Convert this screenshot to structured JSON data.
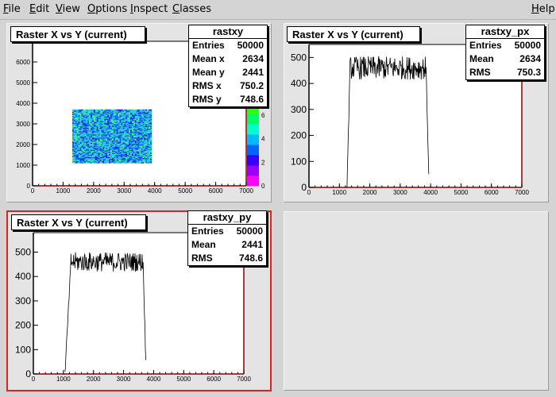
{
  "menu": {
    "items": [
      {
        "label": "File",
        "ul": "F",
        "rest": "ile",
        "x": 4
      },
      {
        "label": "Edit",
        "ul": "E",
        "rest": "dit",
        "x": 37
      },
      {
        "label": "View",
        "ul": "V",
        "rest": "iew",
        "x": 70
      },
      {
        "label": "Options",
        "ul": "O",
        "rest": "ptions",
        "x": 110
      },
      {
        "label": "Inspect",
        "ul": "I",
        "rest": "nspect",
        "x": 164
      },
      {
        "label": "Classes",
        "ul": "C",
        "rest": "lasses",
        "x": 217
      }
    ],
    "help": {
      "label": "Help",
      "ul": "H",
      "rest": "elp"
    }
  },
  "colors": {
    "frame": "#8b0000",
    "pad_bg": "#e4e4e4",
    "selected_border": "#dd2222"
  },
  "chart_data": [
    {
      "type": "heatmap",
      "title": "Raster X vs Y (current)",
      "stats": {
        "name": "rastxy",
        "rows": [
          [
            "Entries",
            "50000"
          ],
          [
            "Mean x",
            "2634"
          ],
          [
            "Mean y",
            "2441"
          ],
          [
            "RMS x",
            "750.2"
          ],
          [
            "RMS y",
            "748.6"
          ]
        ]
      },
      "xlim": [
        0,
        7000
      ],
      "ylim": [
        0,
        7000
      ],
      "x_ticks": [
        "0",
        "1000",
        "2000",
        "3000",
        "4000",
        "5000",
        "6000",
        "7000"
      ],
      "y_ticks": [
        "0",
        "1000",
        "2000",
        "3000",
        "4000",
        "5000",
        "6000"
      ],
      "region": {
        "x": [
          1300,
          3900
        ],
        "y": [
          1100,
          3700
        ]
      },
      "z_ticks": [
        "0",
        "2",
        "4",
        "6"
      ],
      "z_range": [
        0,
        7
      ]
    },
    {
      "type": "line",
      "title": "Raster X vs Y (current)",
      "stats": {
        "name": "rastxy_px",
        "rows": [
          [
            "Entries",
            "50000"
          ],
          [
            "Mean",
            "2634"
          ],
          [
            "RMS",
            "750.3"
          ]
        ]
      },
      "xlim": [
        0,
        7000
      ],
      "ylim": [
        0,
        550
      ],
      "x_ticks": [
        "0",
        "1000",
        "2000",
        "3000",
        "4000",
        "5000",
        "6000",
        "7000"
      ],
      "y_ticks": [
        "0",
        "100",
        "200",
        "300",
        "400",
        "500"
      ],
      "plateau": {
        "x_start": 1350,
        "x_end": 3850,
        "level": 460,
        "noise": 45,
        "edge_left": 1250,
        "edge_right": 3950
      }
    },
    {
      "type": "line",
      "title": "Raster X vs Y (current)",
      "stats": {
        "name": "rastxy_py",
        "rows": [
          [
            "Entries",
            "50000"
          ],
          [
            "Mean",
            "2441"
          ],
          [
            "RMS",
            "748.6"
          ]
        ]
      },
      "xlim": [
        0,
        7000
      ],
      "ylim": [
        0,
        580
      ],
      "x_ticks": [
        "0",
        "1000",
        "2000",
        "3000",
        "4000",
        "5000",
        "6000",
        "7000"
      ],
      "y_ticks": [
        "0",
        "100",
        "200",
        "300",
        "400",
        "500"
      ],
      "plateau": {
        "x_start": 1250,
        "x_end": 3650,
        "level": 460,
        "noise": 40,
        "edge_left": 1050,
        "edge_right": 3750
      }
    }
  ]
}
